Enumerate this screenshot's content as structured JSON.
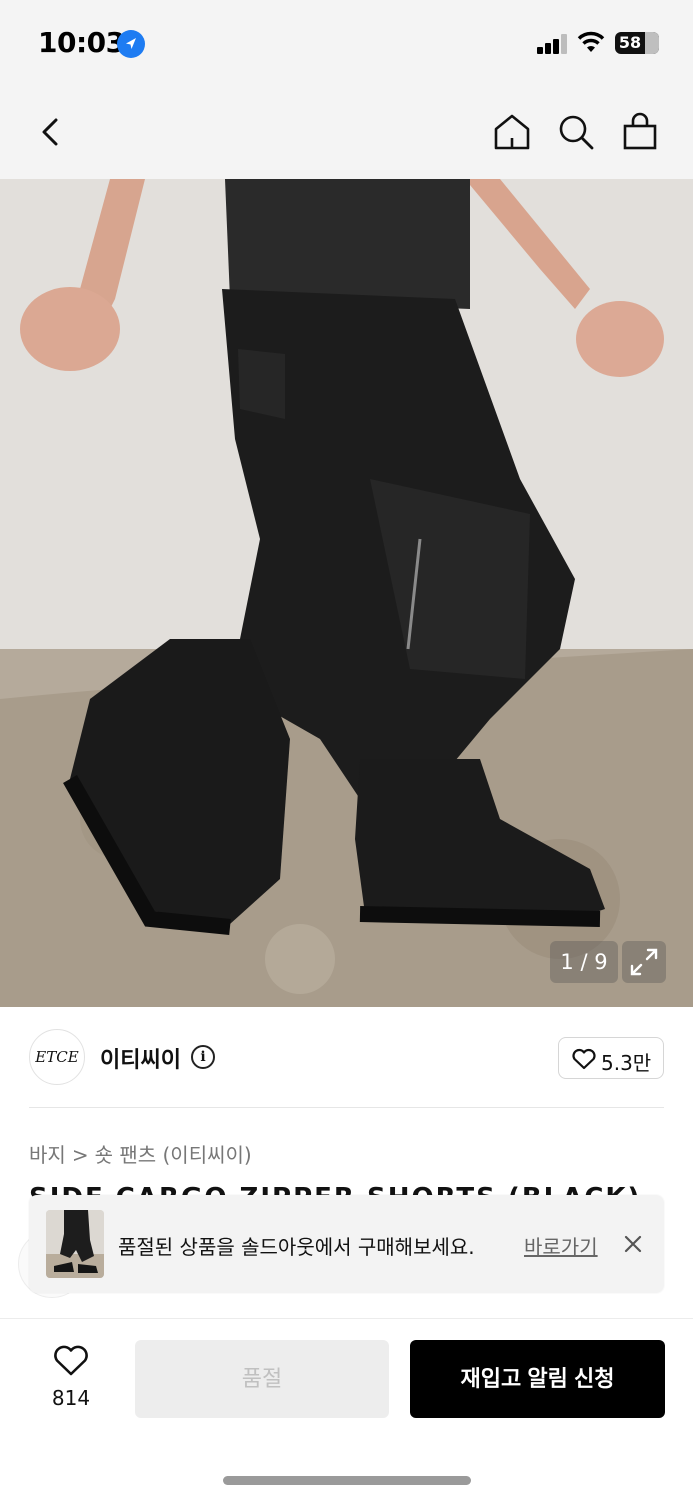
{
  "status_bar": {
    "time": "10:03",
    "battery": "58"
  },
  "nav": {
    "back": "back-icon",
    "home": "home-icon",
    "search": "search-icon",
    "bag": "shopping-bag-icon"
  },
  "gallery": {
    "counter": "1 / 9"
  },
  "brand": {
    "logo_text": "ETCE",
    "name": "이티씨이",
    "likes": "5.3만"
  },
  "breadcrumb": {
    "category": "바지",
    "separator": ">",
    "subcategory": "숏 팬츠 (이티씨이)"
  },
  "product": {
    "title": "SIDE CARGO ZIPPER SHORTS (BLACK)"
  },
  "toast": {
    "message": "품절된 상품을 솔드아웃에서 구매해보세요.",
    "link": "바로가기"
  },
  "bottom_bar": {
    "wish_count": "814",
    "soldout_label": "품절",
    "restock_label": "재입고 알림 신청"
  },
  "colors": {
    "accent": "#000000",
    "location_blue": "#1e7cf2",
    "disabled_bg": "#ededed",
    "disabled_text": "#c0c0c0"
  }
}
